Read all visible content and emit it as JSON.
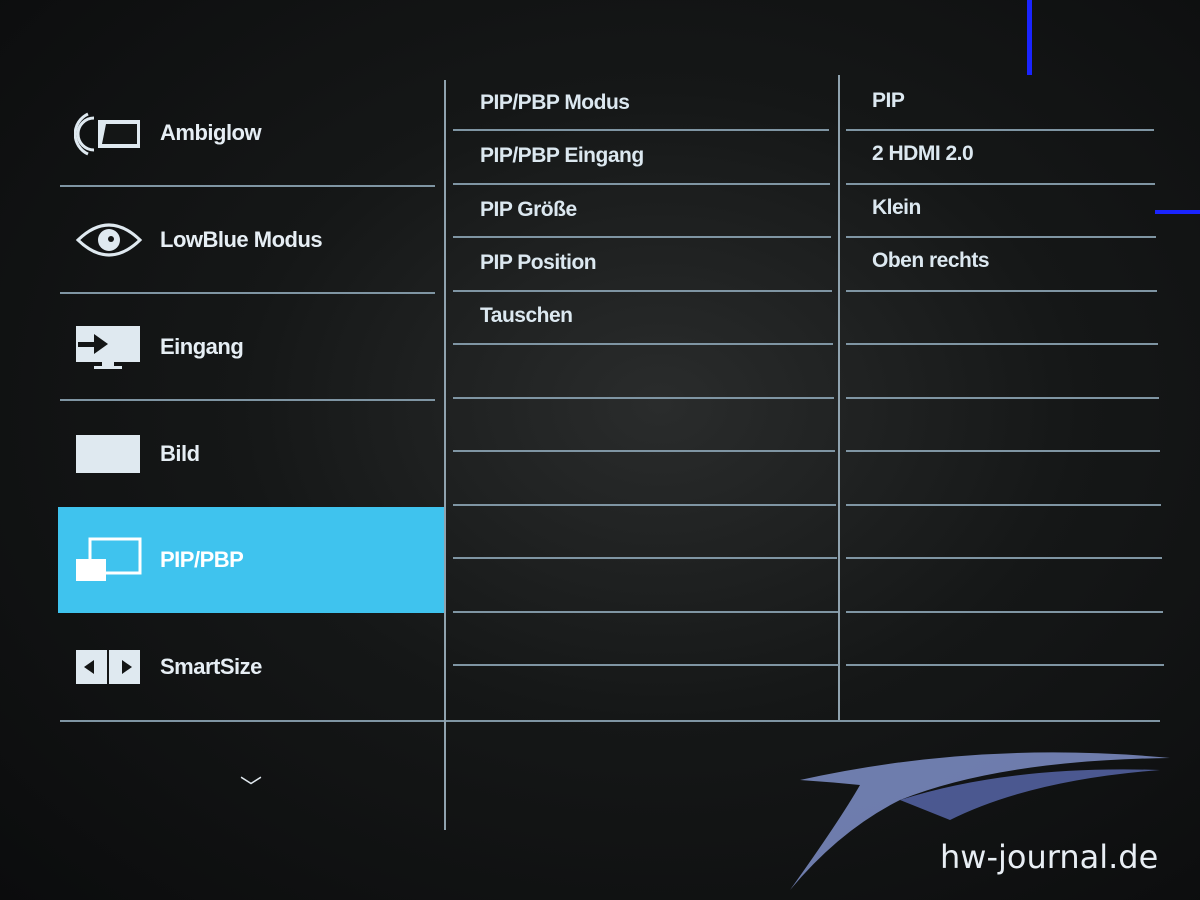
{
  "sidebar": {
    "items": [
      {
        "label": "Ambiglow",
        "icon": "ambiglow-icon"
      },
      {
        "label": "LowBlue Modus",
        "icon": "eye-icon"
      },
      {
        "label": "Eingang",
        "icon": "input-icon"
      },
      {
        "label": "Bild",
        "icon": "picture-icon"
      },
      {
        "label": "PIP/PBP",
        "icon": "pip-icon",
        "selected": true
      },
      {
        "label": "SmartSize",
        "icon": "smartsize-icon"
      }
    ],
    "more_icon": "chevron-down-icon",
    "more_glyph": "﹀"
  },
  "submenu": {
    "items": [
      "PIP/PBP Modus",
      "PIP/PBP Eingang",
      "PIP Größe",
      "PIP Position",
      "Tauschen"
    ]
  },
  "values": {
    "items": [
      "PIP",
      "2 HDMI 2.0",
      "Klein",
      "Oben rechts"
    ]
  },
  "watermark": "hw-journal.de",
  "colors": {
    "highlight": "#3fc3ee",
    "divider": "#7f95a3",
    "text": "#dfe9f0"
  }
}
